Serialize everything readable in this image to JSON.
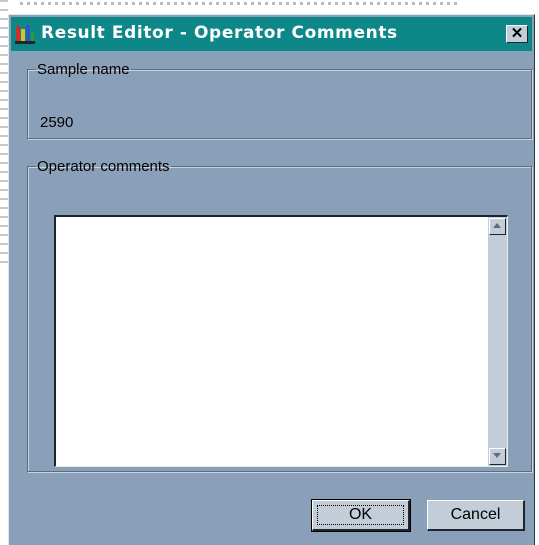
{
  "window": {
    "title": "Result Editor - Operator Comments",
    "close_glyph": "✕",
    "titlebar_color": "#0d8787",
    "body_color": "#8aa0b8"
  },
  "sample": {
    "legend": "Sample name",
    "value": "2590"
  },
  "comments": {
    "legend": "Operator comments",
    "value": ""
  },
  "buttons": {
    "ok_label": "OK",
    "cancel_label": "Cancel"
  },
  "icons": {
    "app": "app-icon",
    "close": "close-icon",
    "scroll_up": "scroll-up-arrow-icon",
    "scroll_down": "scroll-down-arrow-icon"
  }
}
